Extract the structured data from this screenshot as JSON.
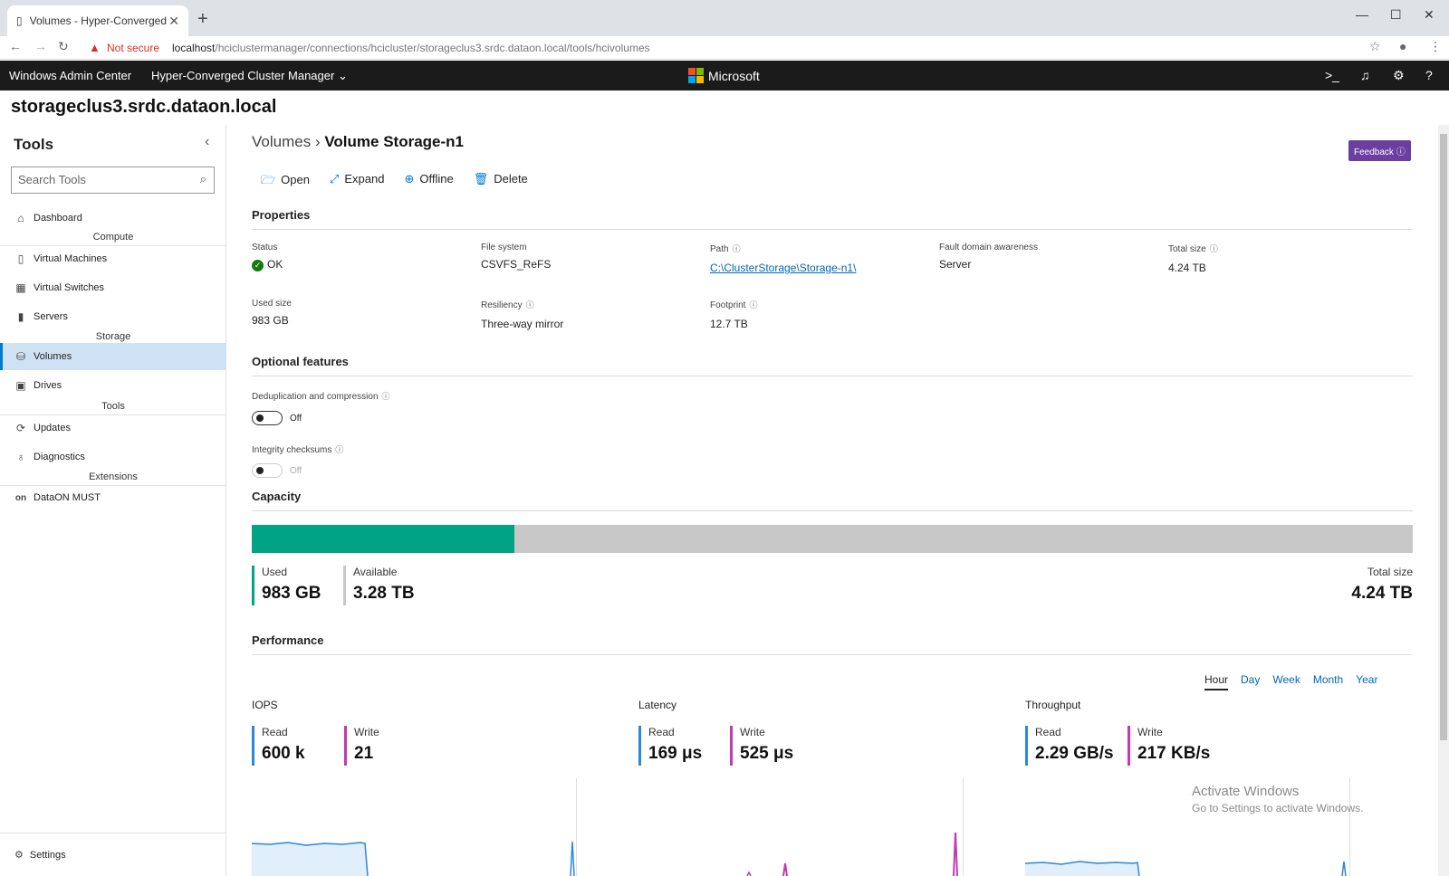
{
  "browser": {
    "tab_title": "Volumes - Hyper-Converged Clu",
    "not_secure": "Not secure",
    "url_host": "localhost",
    "url_path": "/hciclustermanager/connections/hcicluster/storageclus3.srdc.dataon.local/tools/hcivolumes"
  },
  "appbar": {
    "product": "Windows Admin Center",
    "tool": "Hyper-Converged Cluster Manager",
    "brand": "Microsoft"
  },
  "cluster_title": "storageclus3.srdc.dataon.local",
  "sidebar": {
    "heading": "Tools",
    "search_placeholder": "Search Tools",
    "dashboard": "Dashboard",
    "groups": {
      "compute": "Compute",
      "storage": "Storage",
      "tools": "Tools",
      "extensions": "Extensions"
    },
    "items": {
      "vms": "Virtual Machines",
      "switches": "Virtual Switches",
      "servers": "Servers",
      "volumes": "Volumes",
      "drives": "Drives",
      "updates": "Updates",
      "diagnostics": "Diagnostics",
      "dataon": "DataON MUST",
      "dataon_icon": "on"
    },
    "settings": "Settings"
  },
  "breadcrumb": {
    "parent": "Volumes",
    "current": "Volume Storage-n1"
  },
  "feedback": "Feedback",
  "actions": {
    "open": "Open",
    "expand": "Expand",
    "offline": "Offline",
    "delete": "Delete"
  },
  "properties": {
    "heading": "Properties",
    "status_label": "Status",
    "status_value": "OK",
    "fs_label": "File system",
    "fs_value": "CSVFS_ReFS",
    "path_label": "Path",
    "path_value": "C:\\ClusterStorage\\Storage-n1\\",
    "fault_label": "Fault domain awareness",
    "fault_value": "Server",
    "total_label": "Total size",
    "total_value": "4.24 TB",
    "used_label": "Used size",
    "used_value": "983 GB",
    "resiliency_label": "Resiliency",
    "resiliency_value": "Three-way mirror",
    "footprint_label": "Footprint",
    "footprint_value": "12.7 TB"
  },
  "optional": {
    "heading": "Optional features",
    "dedup_label": "Deduplication and compression",
    "dedup_state": "Off",
    "integrity_label": "Integrity checksums",
    "integrity_state": "Off"
  },
  "capacity": {
    "heading": "Capacity",
    "used_fraction": 0.226,
    "used_label": "Used",
    "used_value": "983 GB",
    "available_label": "Available",
    "available_value": "3.28 TB",
    "total_label": "Total size",
    "total_value": "4.24 TB",
    "used_color": "#00a383",
    "available_color": "#c8c8c8"
  },
  "performance": {
    "heading": "Performance",
    "ranges": [
      "Hour",
      "Day",
      "Week",
      "Month",
      "Year"
    ],
    "selected_range": "Hour",
    "iops": {
      "title": "IOPS",
      "read_label": "Read",
      "read_value": "600 k",
      "write_label": "Write",
      "write_value": "21"
    },
    "latency": {
      "title": "Latency",
      "read_label": "Read",
      "read_value": "169 μs",
      "write_label": "Write",
      "write_value": "525 μs"
    },
    "throughput": {
      "title": "Throughput",
      "read_label": "Read",
      "read_value": "2.29 GB/s",
      "write_label": "Write",
      "write_value": "217 KB/s"
    },
    "read_color": "#2b88d8",
    "write_color": "#c239b3"
  },
  "watermark": {
    "line1": "Activate Windows",
    "line2": "Go to Settings to activate Windows."
  }
}
